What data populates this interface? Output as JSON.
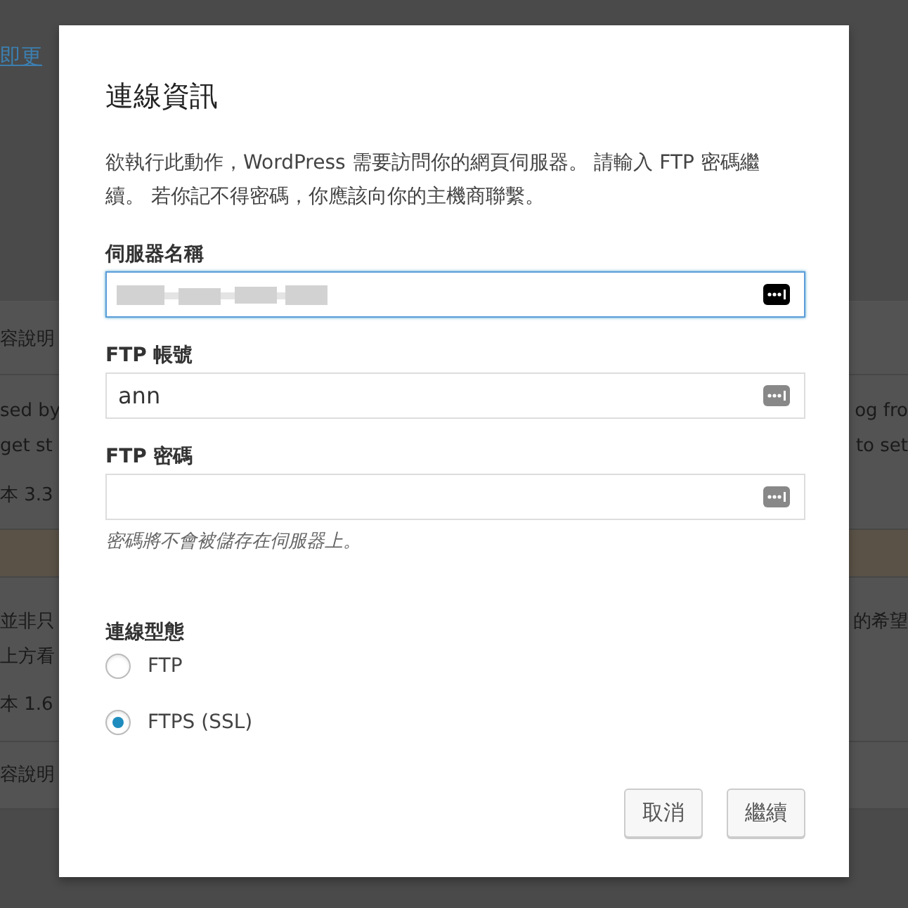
{
  "background": {
    "link": "即更",
    "rows": [
      {
        "kind": "plain",
        "lines": [
          {
            "left": "容說明"
          }
        ]
      },
      {
        "kind": "plain",
        "lines": [
          {
            "left": "sed by",
            "right": "og fro"
          },
          {
            "left": "get st",
            "right": "to set"
          },
          {
            "left": "本 3.3"
          }
        ]
      },
      {
        "kind": "notice",
        "lines": []
      },
      {
        "kind": "plain",
        "lines": [
          {
            "left": "並非只",
            "right": "的希望"
          },
          {
            "left": "上方看"
          },
          {
            "left": "本 1.6"
          }
        ]
      },
      {
        "kind": "plain",
        "lines": [
          {
            "left": "容說明"
          }
        ]
      }
    ]
  },
  "dialog": {
    "title": "連線資訊",
    "description": "欲執行此動作，WordPress 需要訪問你的網頁伺服器。 請輸入 FTP 密碼繼續。 若你記不得密碼，你應該向你的主機商聯繫。",
    "fields": [
      {
        "label": "伺服器名稱",
        "focused": true,
        "value_redacted": true
      },
      {
        "label": "FTP 帳號",
        "focused": false,
        "value": "ann"
      },
      {
        "label": "FTP 密碼",
        "focused": false,
        "hint": "密碼將不會被儲存在伺服器上。"
      }
    ],
    "connection_type": {
      "label": "連線型態",
      "options": [
        {
          "label": "FTP",
          "selected": false
        },
        {
          "label": "FTPS (SSL)",
          "selected": true
        }
      ]
    },
    "buttons": [
      "取消",
      "繼續"
    ]
  }
}
